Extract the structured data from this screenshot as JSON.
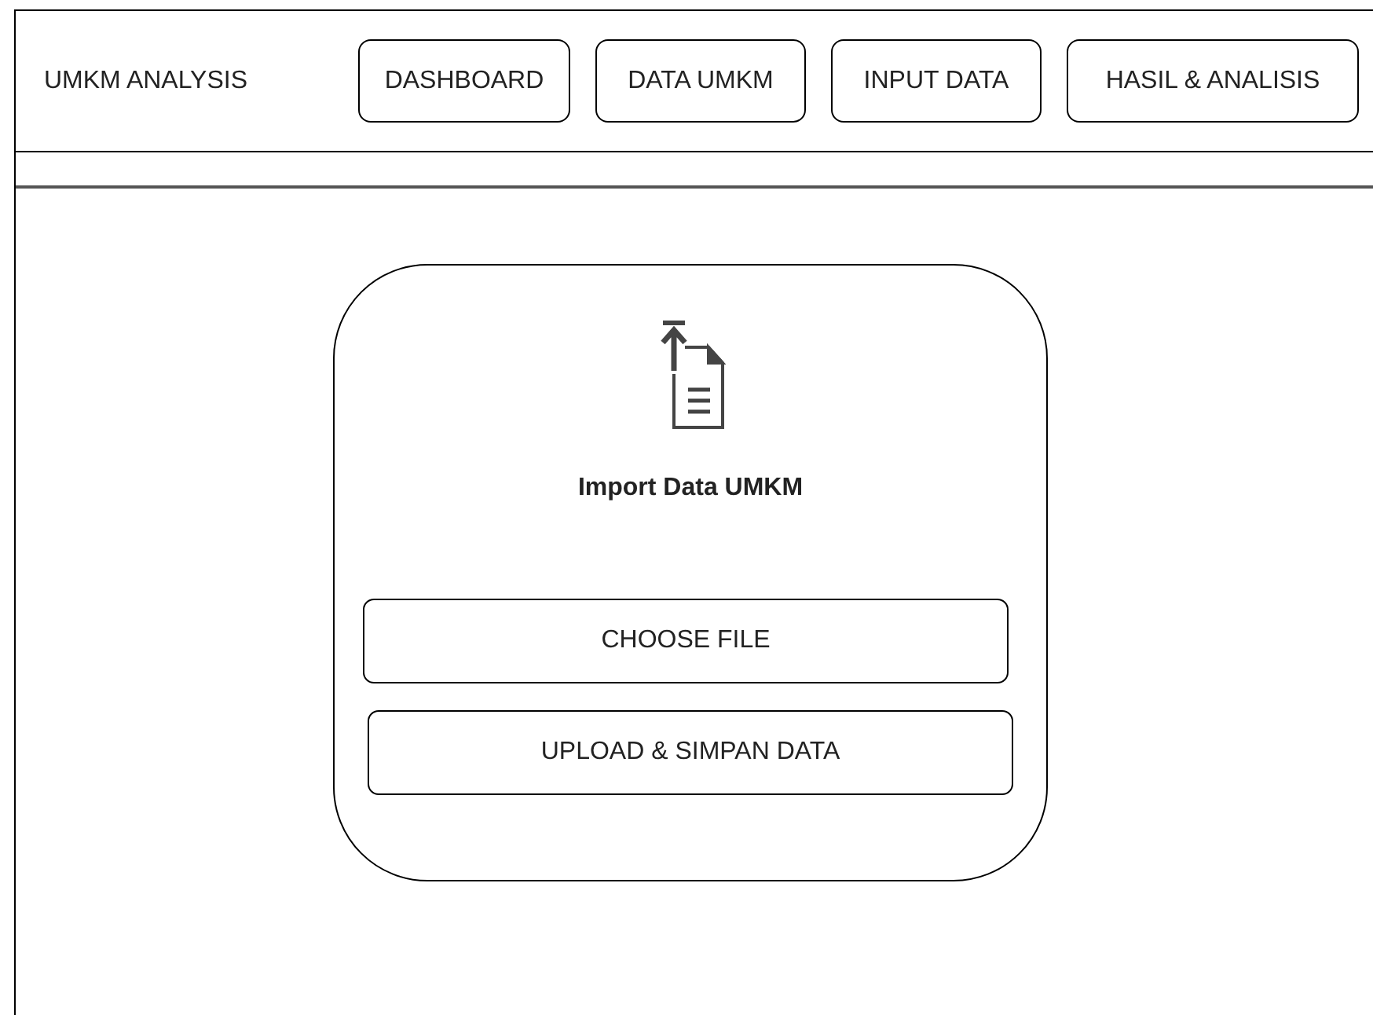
{
  "app_title": "UMKM ANALYSIS",
  "nav": [
    {
      "label": "DASHBOARD"
    },
    {
      "label": "DATA UMKM"
    },
    {
      "label": "INPUT DATA"
    },
    {
      "label": "HASIL & ANALISIS"
    }
  ],
  "import_card": {
    "title": "Import Data UMKM",
    "buttons": [
      "CHOOSE FILE",
      "UPLOAD & SIMPAN DATA"
    ]
  }
}
